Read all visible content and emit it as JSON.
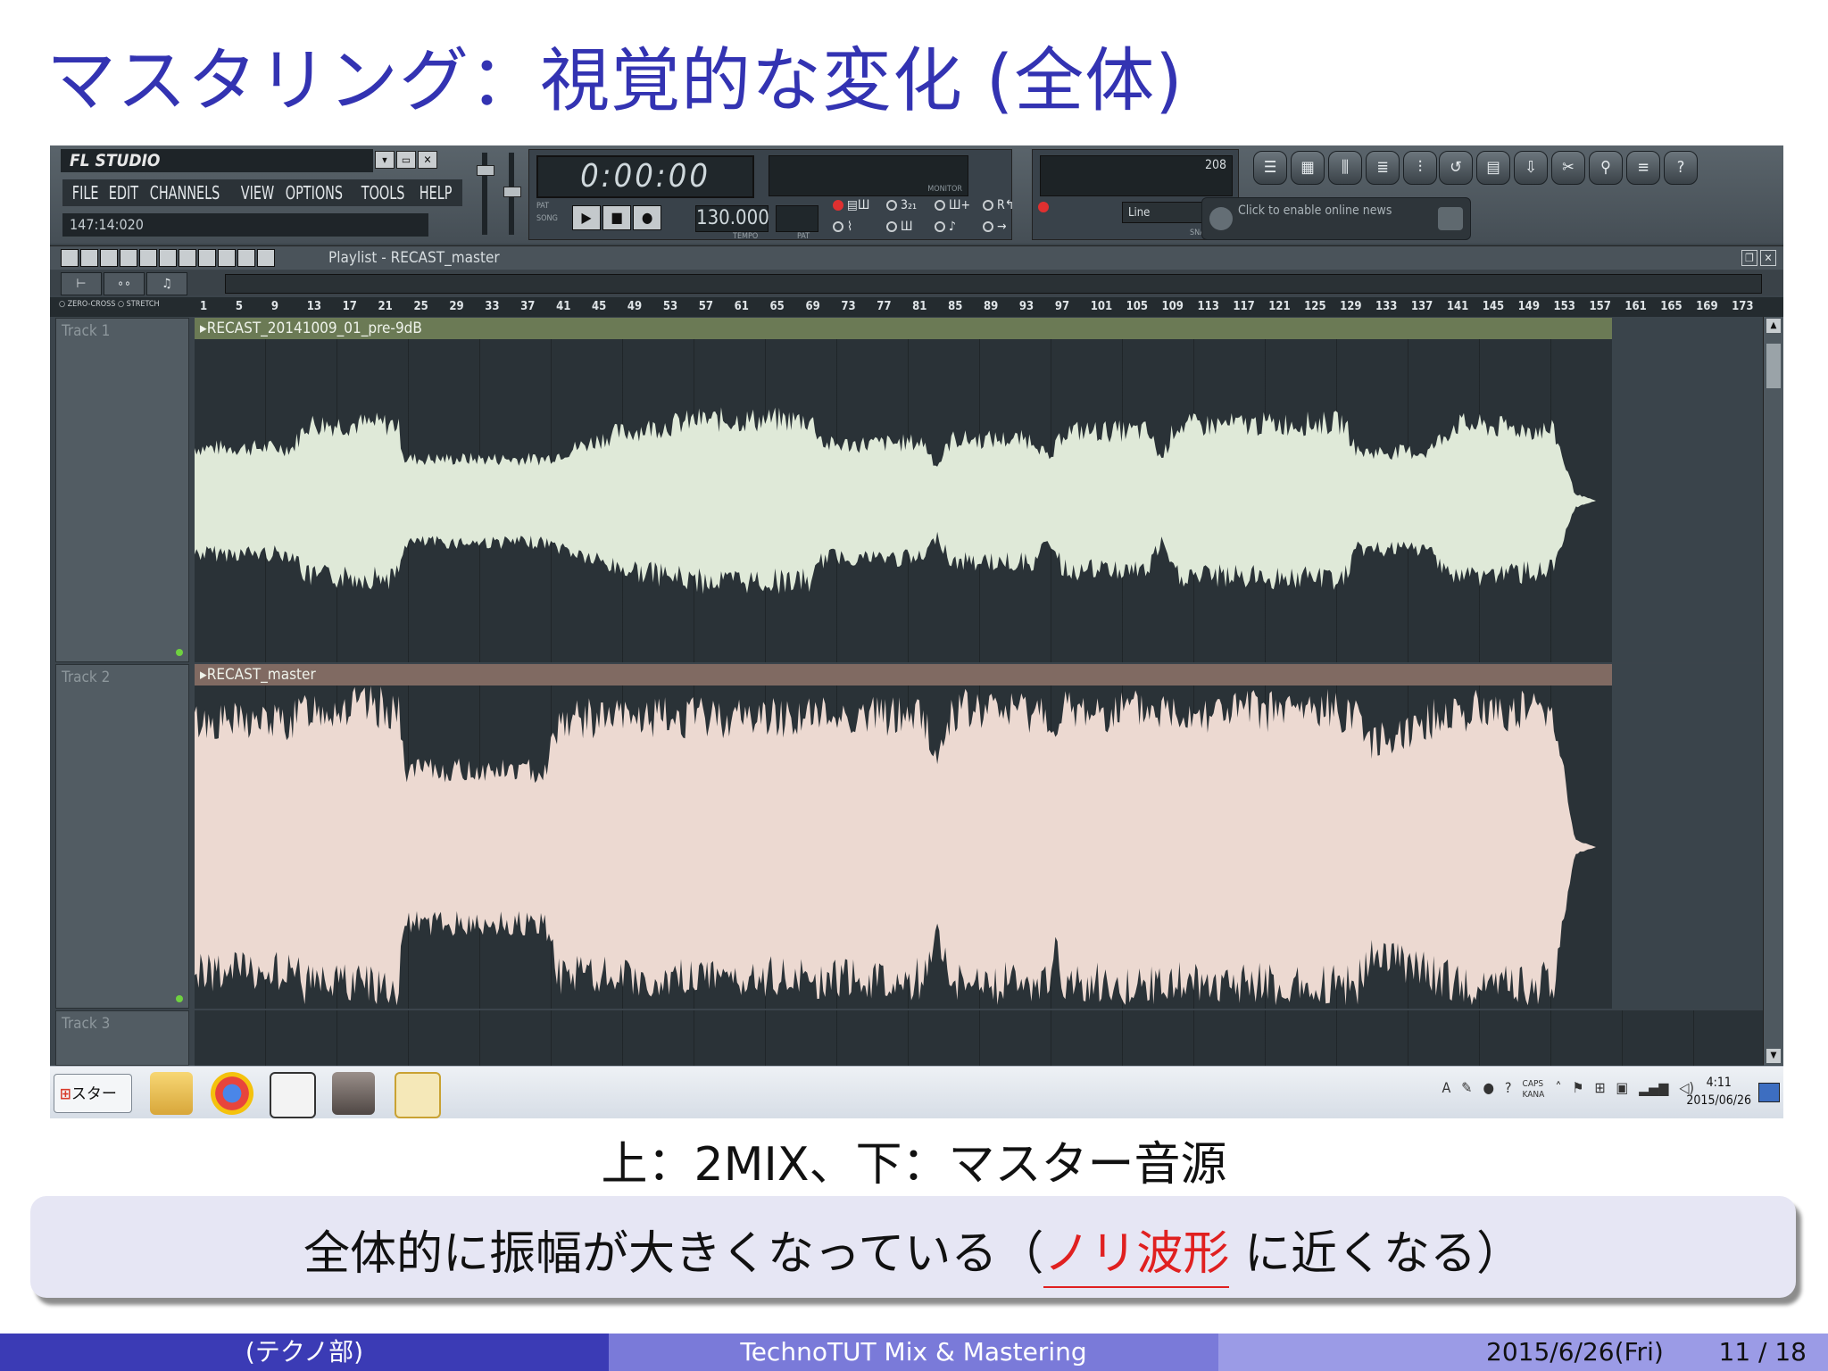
{
  "slide": {
    "title": "マスタリング：視覚的な変化 (全体)",
    "caption": "上：2MIX、下：マスター音源",
    "summary_before": "全体的に振幅が大きくなっている（",
    "summary_highlight": "ノリ波形",
    "summary_after": " に近くなる）",
    "highlight_color": "#e02020"
  },
  "footer": {
    "left": "(テクノ部)",
    "center": "TechnoTUT Mix & Mastering",
    "date": "2015/6/26(Fri)",
    "page": "11 / 18"
  },
  "fl": {
    "logo": "FL STUDIO",
    "menu": [
      "FILE",
      "EDIT",
      "CHANNELS",
      "VIEW",
      "OPTIONS",
      "TOOLS",
      "HELP"
    ],
    "hint": "147:14:020",
    "time": "0:00:00",
    "tempo": "130.000",
    "tempo_label": "TEMPO",
    "pat_label": "PAT",
    "monitor_label": "MONITOR",
    "perf_value": "208",
    "snap": "Line",
    "snap_label": "SNAP",
    "news": "Click to enable online news",
    "playlist_title": "Playlist - RECAST_master",
    "zero_cross": "ZERO-CROSS",
    "stretch": "STRETCH",
    "ruler": [
      "1",
      "5",
      "9",
      "13",
      "17",
      "21",
      "25",
      "29",
      "33",
      "37",
      "41",
      "45",
      "49",
      "53",
      "57",
      "61",
      "65",
      "69",
      "73",
      "77",
      "81",
      "85",
      "89",
      "93",
      "97",
      "101",
      "105",
      "109",
      "113",
      "117",
      "121",
      "125",
      "129",
      "133",
      "137",
      "141",
      "145",
      "149",
      "153",
      "157",
      "161",
      "165",
      "169",
      "173"
    ],
    "tracks": [
      {
        "name": "Track 1",
        "clip": "RECAST_20141009_01_pre-9dB",
        "clip_color": "#6b7a55",
        "wave_color": "#dfe9d8"
      },
      {
        "name": "Track 2",
        "clip": "RECAST_master",
        "clip_color": "#806a62",
        "wave_color": "#ecd9d1"
      },
      {
        "name": "Track 3"
      }
    ]
  },
  "taskbar": {
    "start": "スタート",
    "caps": "CAPS",
    "kana": "KANA",
    "time": "4:11",
    "date": "2015/06/26"
  }
}
